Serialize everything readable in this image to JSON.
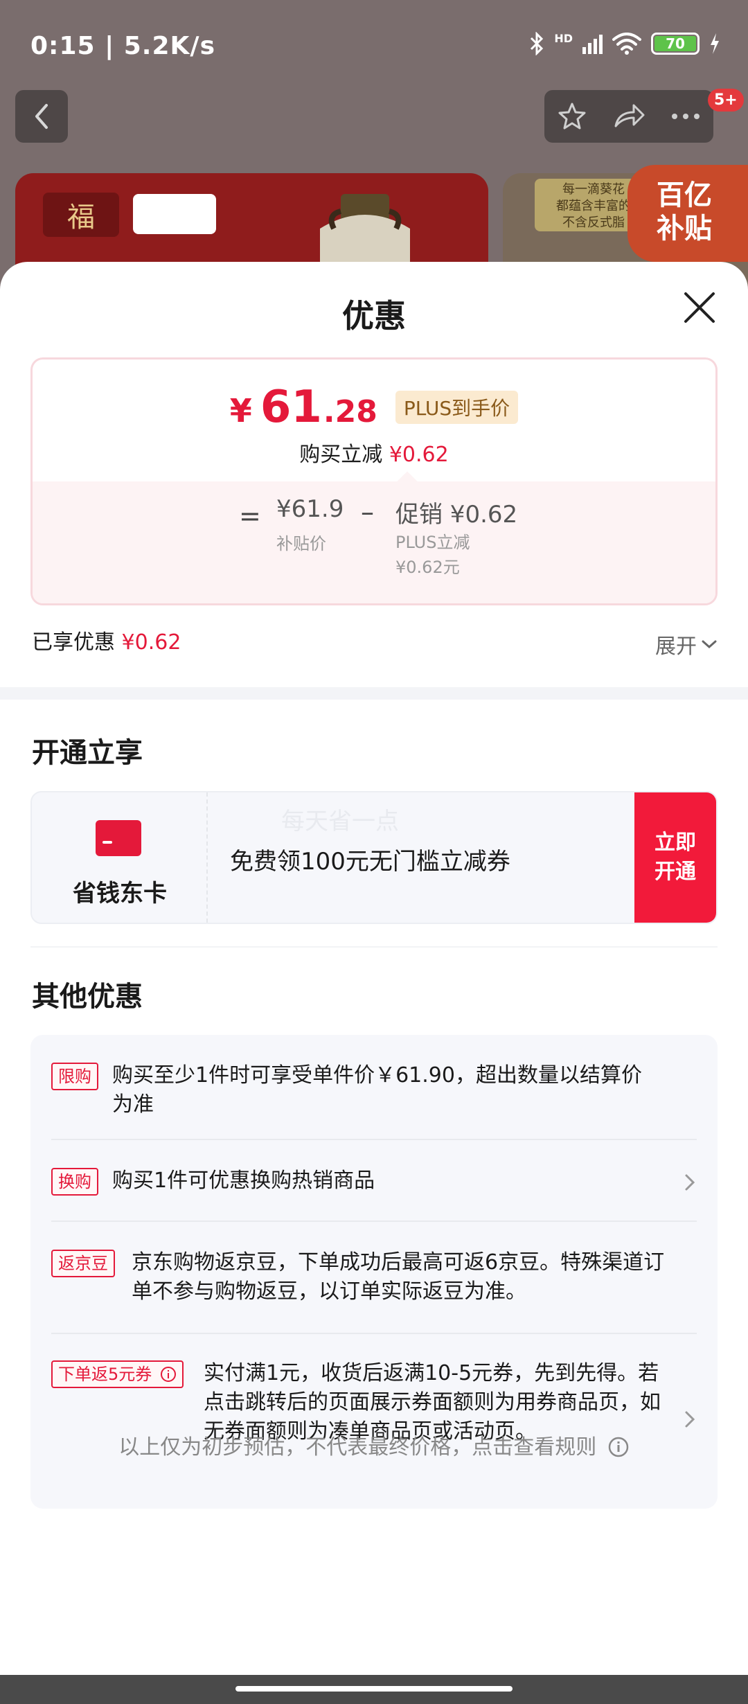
{
  "status_bar": {
    "time_speed": "0:15 | 5.2K/s",
    "battery": "70",
    "network": "HD"
  },
  "background": {
    "badge": "5+",
    "banner_right_text": "每一滴葵花\n都蕴含丰富的\n不含反式脂",
    "subsidy_label": "百亿\n补贴",
    "logo_text": "福"
  },
  "sheet": {
    "title": "优惠"
  },
  "price_card": {
    "yen": "¥",
    "price_int": "61",
    "price_dec": ".28",
    "plus_tag": "PLUS到手价",
    "instant_cut_label": "购买立减",
    "instant_cut_value": "¥0.62",
    "equals": "=",
    "subsidy_price": "¥61.9",
    "subsidy_price_label": "补贴价",
    "minus": "–",
    "promo_line": "促销 ¥0.62",
    "promo_detail_1": "PLUS立减",
    "promo_detail_2": "¥0.62元"
  },
  "enjoyed": {
    "label": "已享优惠",
    "value": "¥0.62",
    "expand_label": "展开"
  },
  "open_section": {
    "title": "开通立享",
    "card_name": "省钱东卡",
    "watermark": "每天省一点",
    "description": "免费领100元无门槛立减券",
    "button_label": "立即\n开通"
  },
  "other_section": {
    "title": "其他优惠",
    "items": [
      {
        "tag": "限购",
        "text": "购买至少1件时可享受单件价￥61.90，超出数量以结算价为准"
      },
      {
        "tag": "换购",
        "text": "购买1件可优惠换购热销商品"
      },
      {
        "tag": "返京豆",
        "text": "京东购物返京豆，下单成功后最高可返6京豆。特殊渠道订单不参与购物返豆，以订单实际返豆为准。"
      },
      {
        "tag": "下单返5元券",
        "text": "实付满1元，收货后返满10-5元券，先到先得。若点击跳转后的页面展示券面额则为用券商品页，如无券面额则为凑单商品页或活动页。"
      }
    ]
  },
  "footer": {
    "note": "以上仅为初步预估，不代表最终价格，点击查看规则"
  },
  "colors": {
    "accent_red": "#e4193a",
    "plus_gold": "#8a5a1a",
    "panel_bg": "#f6f7fb"
  }
}
